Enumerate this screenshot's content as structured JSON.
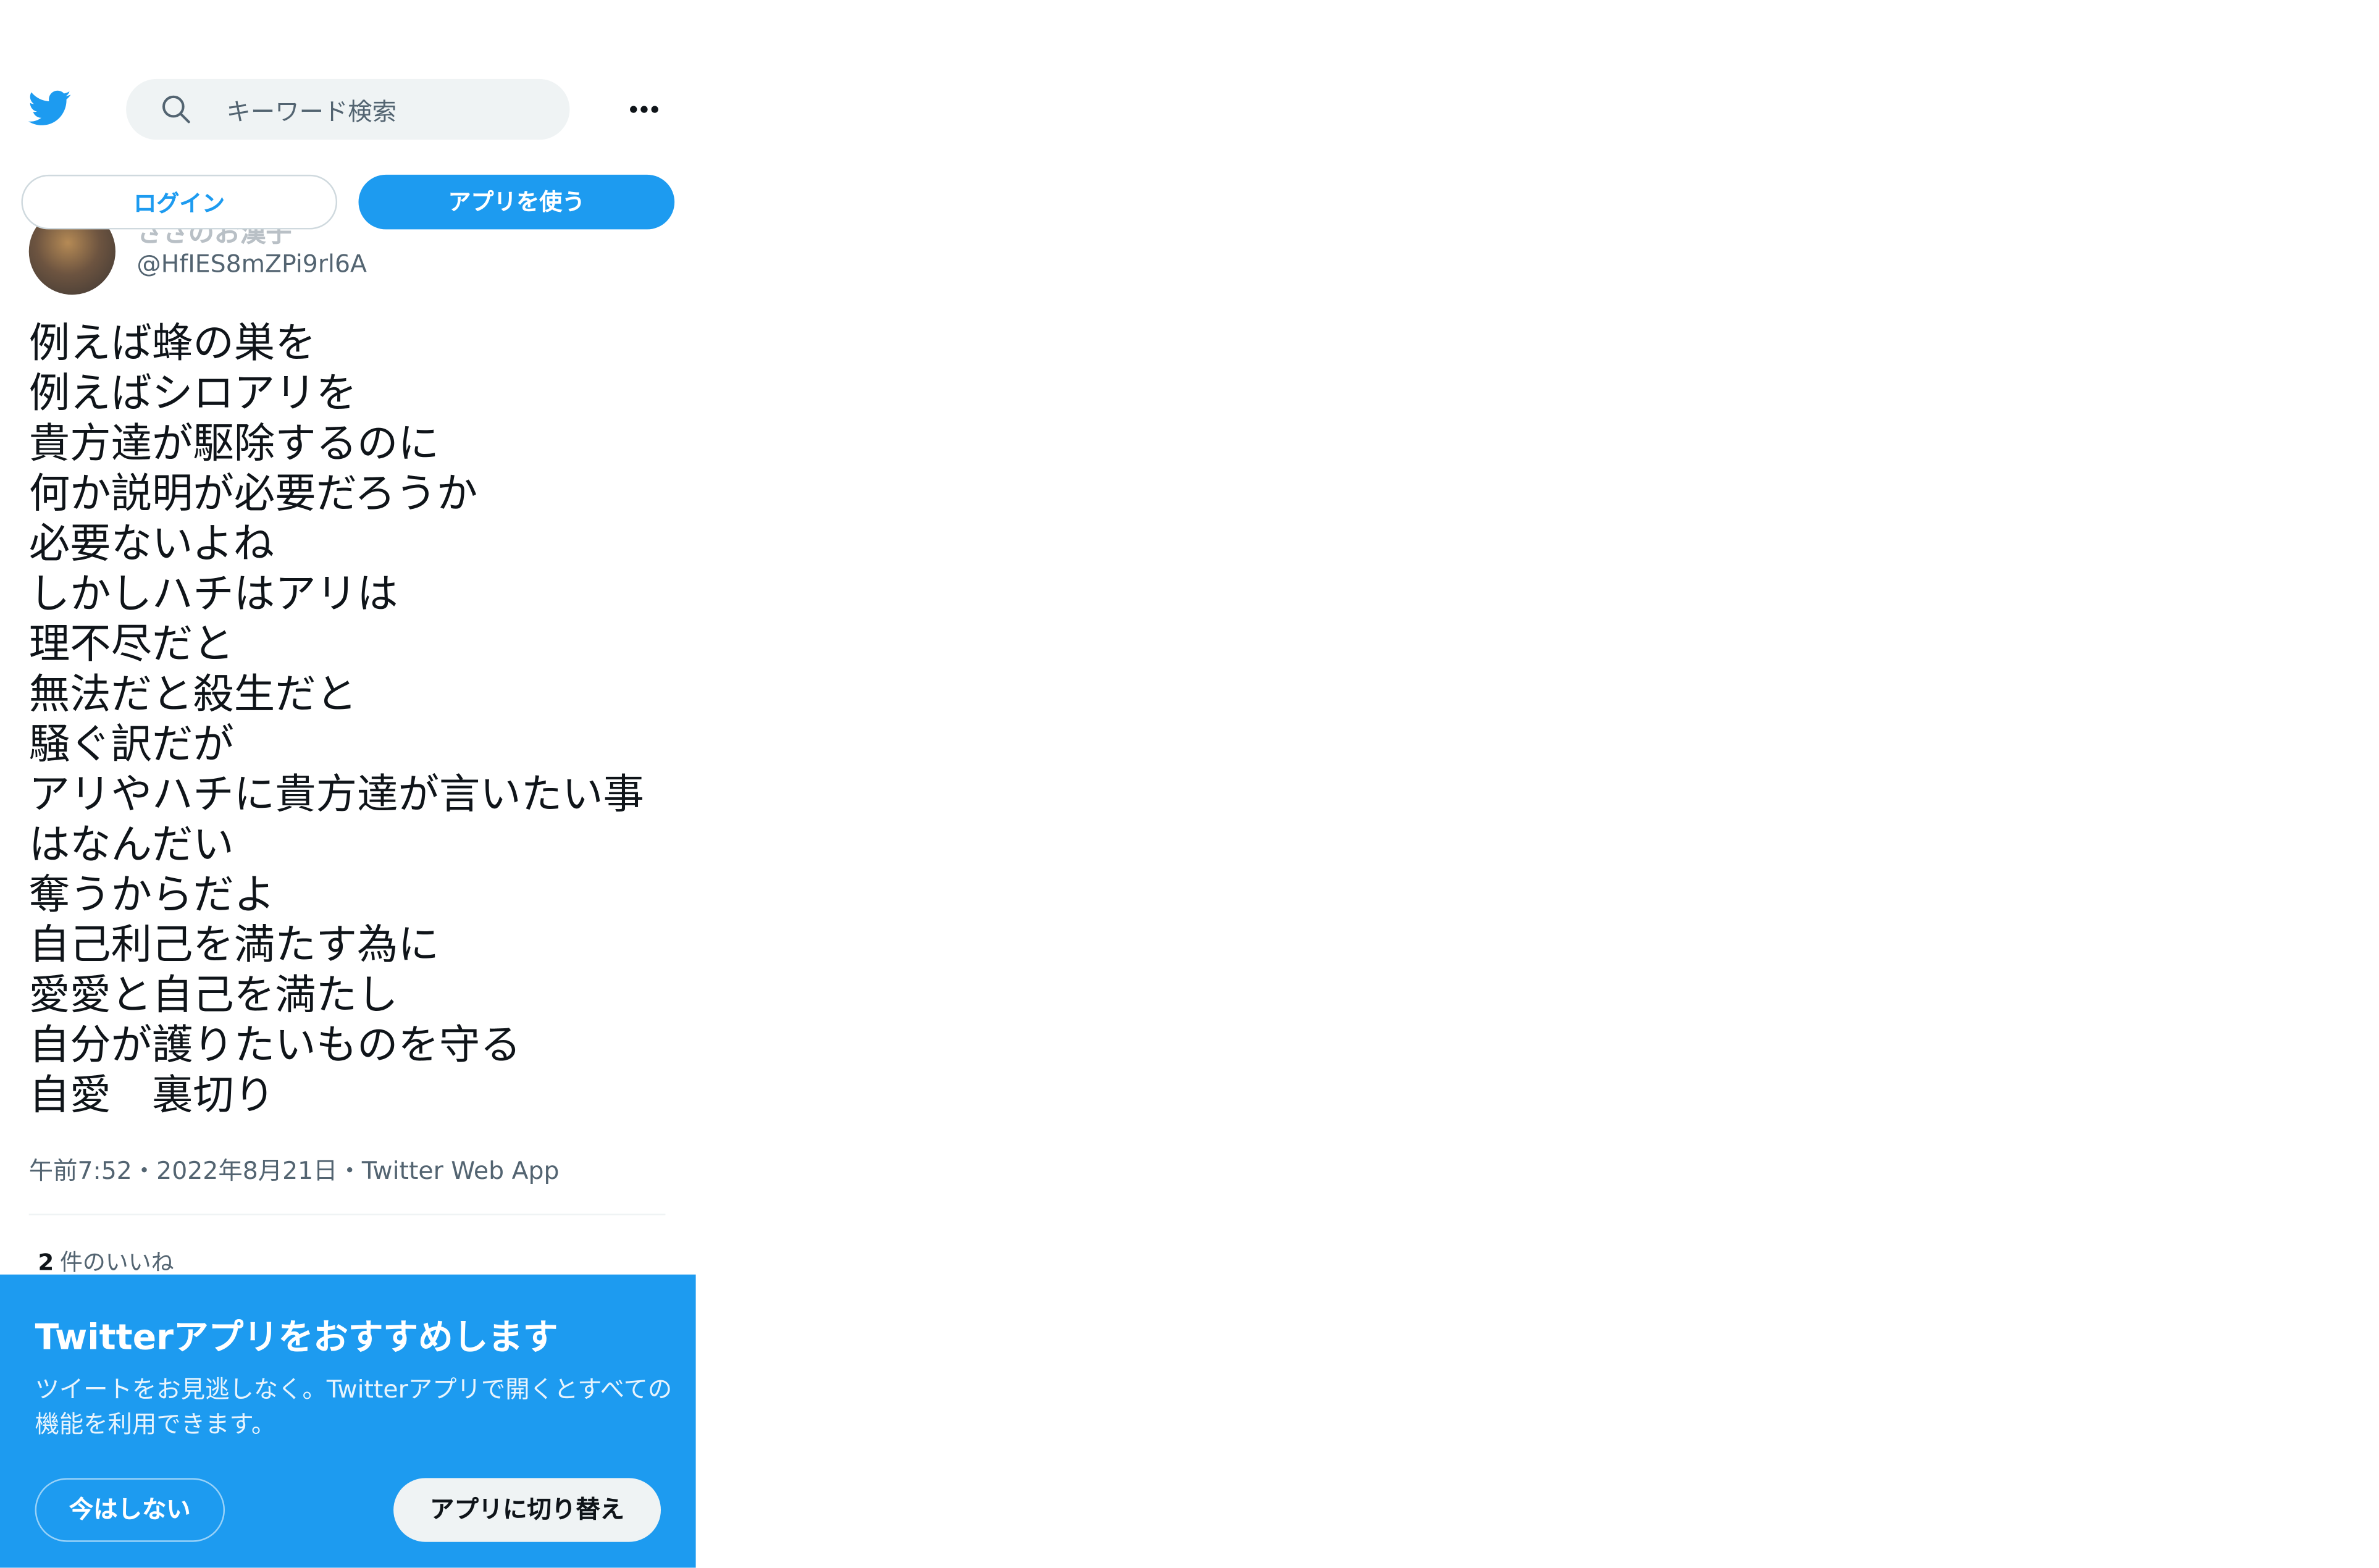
{
  "header": {
    "logo_icon": "twitter-bird-icon",
    "search_placeholder": "キーワード検索",
    "search_icon": "search-icon",
    "more_icon": "more-dots-icon"
  },
  "actions": {
    "login_label": "ログイン",
    "use_app_label": "アプリを使う"
  },
  "tweet": {
    "display_name": "ささのお漢子",
    "handle": "@HfIES8mZPi9rl6A",
    "text": "例えば蜂の巣を\n例えばシロアリを\n貴方達が駆除するのに\n何か説明が必要だろうか\n必要ないよね\nしかしハチはアリは\n理不尽だと\n無法だと殺生だと\n騒ぐ訳だが\nアリやハチに貴方達が言いたい事はなんだい\n奪うからだよ\n自己利己を満たす為に\n愛愛と自己を満たし\n自分が護りたいものを守る\n自愛　裏切り",
    "meta": "午前7:52・2022年8月21日・Twitter Web App",
    "likes_count": "2",
    "likes_label": "件のいいね"
  },
  "banner": {
    "title": "Twitterアプリをおすすめします",
    "body": "ツイートをお見逃しなく。Twitterアプリで開くとすべての機能を利用できます。",
    "not_now_label": "今はしない",
    "switch_label": "アプリに切り替え"
  },
  "colors": {
    "brand_blue": "#1d9bf0",
    "text_primary": "#0f1419",
    "text_secondary": "#536471"
  }
}
